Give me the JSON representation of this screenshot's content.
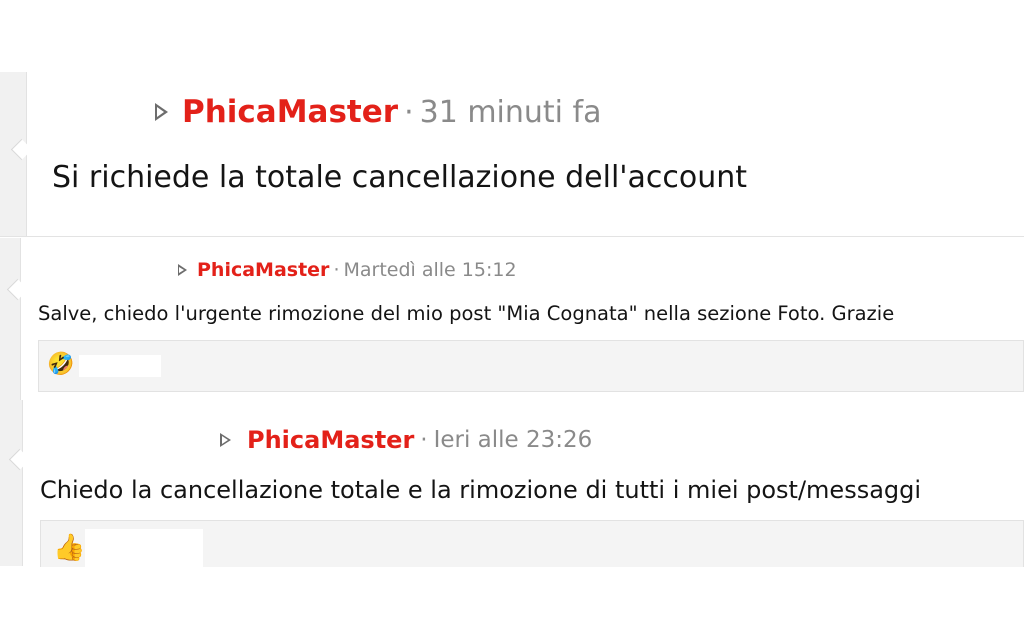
{
  "posts": [
    {
      "author": "PhicaMaster",
      "separator": "·",
      "time": "31 minuti fa",
      "message": "Si richiede la totale cancellazione dell'account"
    },
    {
      "author": "PhicaMaster",
      "separator": "·",
      "time": "Martedì alle 15:12",
      "message": "Salve, chiedo l'urgente rimozione del mio post \"Mia Cognata\" nella sezione Foto. Grazie",
      "reaction": {
        "icon": "rofl-emoji-icon",
        "glyph": "🤣"
      }
    },
    {
      "author": "PhicaMaster",
      "separator": "·",
      "time": "Ieri alle 23:26",
      "message": "Chiedo la cancellazione totale e la rimozione di tutti i miei post/messaggi",
      "reaction": {
        "icon": "thumbs-up-icon",
        "glyph": "👍"
      }
    }
  ],
  "colors": {
    "author": "#e32119",
    "meta": "#8a8a8a",
    "text": "#141414",
    "gutter": "#f1f1f1"
  }
}
